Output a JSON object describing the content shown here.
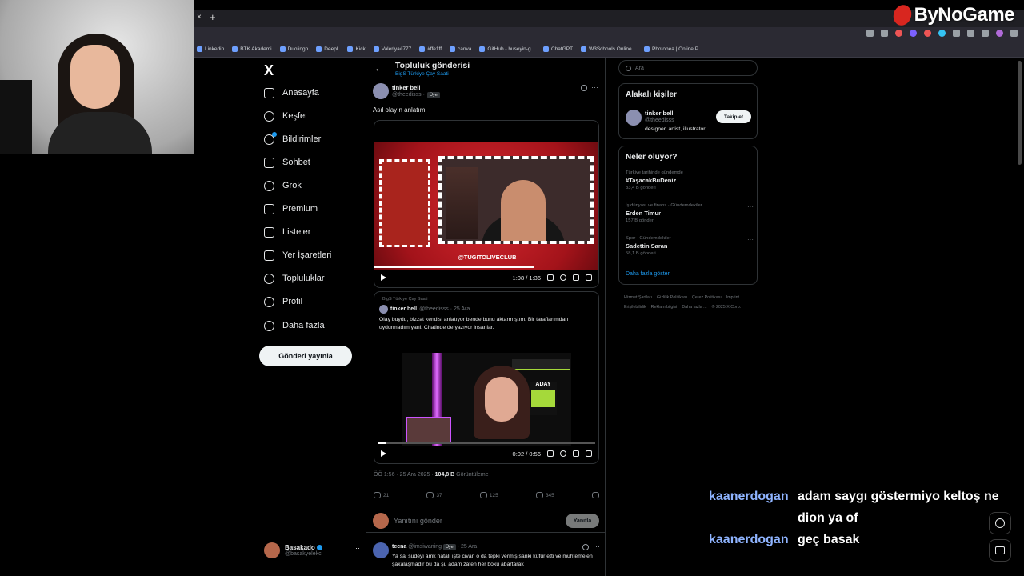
{
  "browser": {
    "close_glyph": "×",
    "new_tab_glyph": "+",
    "bookmarks": [
      "Linkedin",
      "BTK Akademi",
      "Duolingo",
      "DeepL",
      "Kick",
      "Valeriya#777",
      "#ffe1ff",
      "canva",
      "GitHub - huseyin-g...",
      "ChatGPT",
      "W3Schools Online...",
      "Photopea | Online P..."
    ]
  },
  "watermark": {
    "text": "ByNoGame"
  },
  "nav": {
    "logo": "X",
    "items": [
      "Anasayfa",
      "Keşfet",
      "Bildirimler",
      "Sohbet",
      "Grok",
      "Premium",
      "Listeler",
      "Yer İşaretleri",
      "Topluluklar",
      "Profil",
      "Daha fazla"
    ],
    "post_button": "Gönderi yayınla",
    "account": {
      "name": "Basakado",
      "handle": "@basakyelekci",
      "more": "···"
    }
  },
  "header": {
    "back": "←",
    "title": "Topluluk gönderisi",
    "community": "BigS Türkiye Çay Saati"
  },
  "post": {
    "author": "tinker bell",
    "handle": "@theedisss",
    "separator": "·",
    "role_badge": "Üye",
    "more": "···",
    "text": "Asıl olayın anlatımı",
    "video": {
      "overlay_tag": "@TUGITOLIVECLUB",
      "time": "1:08 / 1:36",
      "progress": 0.71
    },
    "quote": {
      "community": "BigS Türkiye Çay Saati",
      "author": "tinker bell",
      "handle_date": "@theedisss · 25 Ara",
      "text": "Olay buydu, bizzat kendisi anlatıyor bende bunu aktarmıştım. Bir taraflarımdan uydurmadım yani. Chatinde de yazıyor insanlar.",
      "video": {
        "badge": "ADAY",
        "time": "0:02 / 0:56",
        "progress": 0.04
      }
    },
    "meta": {
      "datetime": "ÖÖ 1:56 · 25 Ara 2025 · ",
      "views": "104,8 B",
      "views_label": " Görüntüleme"
    },
    "actions": {
      "replies": "21",
      "reposts": "37",
      "likes": "125",
      "bookmarks": "345"
    }
  },
  "reply_box": {
    "placeholder": "Yanıtını gönder",
    "button": "Yanıtla"
  },
  "reply": {
    "author": "tecna",
    "handle": "@imsiwaning",
    "badge": "Üye",
    "date": "· 25 Ara",
    "more": "···",
    "text": "Ya sal sudeyi amk hatalı işte civan o da tepki vermiş sanki küfür etti ve muhtemelen şakalaşmadır bu da şu adam zaten her boku abartarak"
  },
  "right": {
    "search_placeholder": "Ara",
    "related": {
      "title": "Alakalı kişiler",
      "name": "tinker bell",
      "handle": "@theedisss",
      "bio": "designer, artist, illustrator",
      "follow": "Takip et"
    },
    "trends": {
      "title": "Neler oluyor?",
      "items": [
        {
          "context": "Türkiye tarihinde gündemde",
          "topic": "#TaşacakBuDeniz",
          "count": "33,4 B gönderi"
        },
        {
          "context": "İş dünyası ve finans · Gündemdekiler",
          "topic": "Erden Timur",
          "count": "157 B gönderi"
        },
        {
          "context": "Spor · Gündemdekiler",
          "topic": "Sadettin Saran",
          "count": "58,1 B gönderi"
        }
      ],
      "more_glyph": "···",
      "show_more": "Daha fazla göster"
    },
    "footer": [
      "Hizmet Şartları",
      "Gizlilik Politikası",
      "Çerez Politikası",
      "Imprint",
      "Erişilebilirlik",
      "Reklam bilgisi",
      "Daha fazla ...",
      "© 2025 X Corp."
    ]
  },
  "stream_chat": [
    {
      "user": "kaanerdogan",
      "text": "adam saygı göstermiyo keltoş ne",
      "cont": "dion ya of"
    },
    {
      "user": "kaanerdogan",
      "text": "geç basak"
    }
  ],
  "colors": {
    "accent": "#1d9bf0",
    "bg": "#000000",
    "border": "#2f3336",
    "chat_user": "#8fb4ff",
    "brand": "#d8261f"
  }
}
